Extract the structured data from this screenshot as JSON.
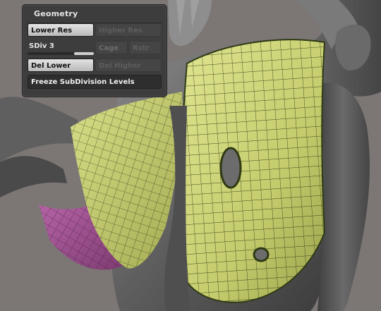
{
  "geometry": {
    "title": "Geometry",
    "lower_res": "Lower Res",
    "higher_res": "Higher Res",
    "sdiv": {
      "label": "SDiv 3",
      "level": 3,
      "max": 3
    },
    "cage": "Cage",
    "rstr": "Rstr",
    "del_lower": "Del Lower",
    "del_higher": "Del Higher",
    "freeze": "Freeze SubDivision Levels"
  },
  "icons": {
    "viewport": "sculpt-model-viewport"
  },
  "colors": {
    "background": "#7c7674",
    "clay": "#6f6f6f",
    "vest": "#cfd67c",
    "wire": "#2f3a14",
    "magenta": "#a45694",
    "panel": "#3d3d3d"
  }
}
